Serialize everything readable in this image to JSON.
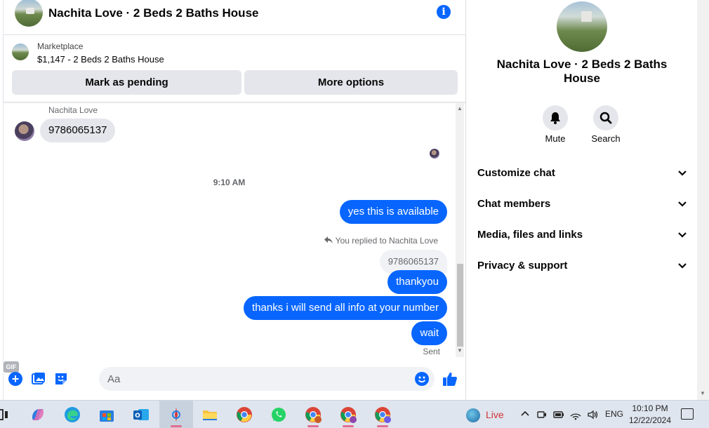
{
  "conversation": {
    "title": "Nachita Love · 2 Beds 2 Baths House"
  },
  "marketplace": {
    "label": "Marketplace",
    "listing": "$1,147 - 2 Beds 2 Baths House",
    "mark_pending": "Mark as pending",
    "more_options": "More options"
  },
  "messages": {
    "sender_name": "Nachita Love",
    "incoming": "9786065137",
    "time": "9:10 AM",
    "outgoing_1": "yes this is available",
    "replied_note": "You replied to Nachita Love",
    "quoted": "9786065137",
    "outgoing_2": "thankyou",
    "outgoing_3": "thanks i will send all info at your number",
    "outgoing_4": "wait",
    "status": "Sent"
  },
  "composer": {
    "placeholder": "Aa",
    "gif_label": "GIF"
  },
  "panel": {
    "title": "Nachita Love · 2 Beds 2 Baths House",
    "mute_label": "Mute",
    "search_label": "Search",
    "sections": [
      "Customize chat",
      "Chat members",
      "Media, files and links",
      "Privacy & support"
    ]
  },
  "taskbar": {
    "live_label": "Live",
    "language": "ENG",
    "time": "10:10 PM",
    "date": "12/22/2024"
  },
  "colors": {
    "accent": "#0866ff",
    "bubble_incoming": "#e4e6eb",
    "taskbar": "#dfe5ee"
  }
}
